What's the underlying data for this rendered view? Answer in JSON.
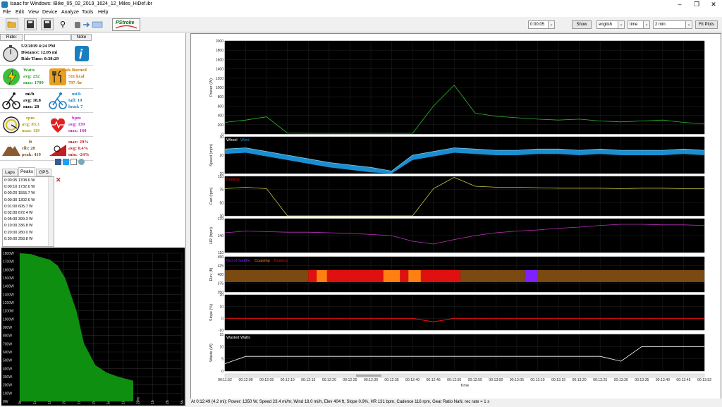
{
  "window": {
    "title": "Isaac for Windows: IBike_05_02_2019_1624_12_Miles_HiDef.ibr",
    "minimize": "–",
    "maximize": "❐",
    "close": "✕"
  },
  "menu": [
    "File",
    "Edit",
    "View",
    "Device",
    "Analyze",
    "Tools",
    "Help"
  ],
  "toolbar": {
    "pstroke_label": "PStroke",
    "interval": "0:00:05",
    "show_label": "Show",
    "units": "english",
    "xaxis": "time",
    "window": "2 min",
    "fit_label": "Fit Plots"
  },
  "ride": {
    "ride_tab": "Ride:",
    "note_tab": "Note",
    "date": "5/2/2019 4:24 PM",
    "distance": "Distance: 12.05 mi",
    "ride_time": "Ride Time: 0:38:29",
    "watts": {
      "label": "Watts",
      "avg": "avg: 232",
      "max": "max: 1709"
    },
    "cals": {
      "label": "Cals Burned",
      "total": "511 kcal",
      "rate": "797 /hr"
    },
    "speed": {
      "label": "mi/h",
      "avg": "avg: 18.8",
      "max": "max: 28"
    },
    "wind": {
      "label": "mi/h",
      "tail": "tail: 19",
      "head": "head: 7"
    },
    "cadence": {
      "label": "rpm",
      "avg": "avg: 83.3",
      "max": "max: 119"
    },
    "heart": {
      "label": "bpm",
      "avg": "avg: 139",
      "max": "max: 160"
    },
    "climb": {
      "label": "ft",
      "climb": "clb: 28",
      "peak": "peak: 419"
    },
    "slope": {
      "max": "max: 29%",
      "avg": "avg: 0.4%",
      "min": "min: -24%"
    }
  },
  "tabs": [
    "Laps",
    "Peaks",
    "GPS"
  ],
  "peaks": [
    "0:00:05 1708.6 W",
    "0:00:10 1732.6 W",
    "0:00:20 1555.7 W",
    "0:00:30 1302.6 W",
    "0:01:00 605.7 W",
    "0:02:00 672.4 W",
    "0:05:00 399.3 W",
    "0:10:00 336.8 W",
    "0:20:00 280.0 W",
    "0:30:00 258.8 W"
  ],
  "colors": {
    "power": "#2fb82f",
    "wind": "#1a8ed0",
    "cadence": "#c8c840",
    "hr": "#c030c0",
    "elev": "#7a4a10",
    "slope": "#e01010",
    "peaks_fill": "#0f8f0f",
    "out_of_saddle": "#8020ff",
    "coasting": "#ff8010",
    "braking": "#e01010"
  },
  "chart_data": [
    {
      "type": "area",
      "title": "",
      "xlabel": "",
      "ylabel": "",
      "yticks": [
        "1800W",
        "1700W",
        "1600W",
        "1500W",
        "1400W",
        "1300W",
        "1200W",
        "1100W",
        "1000W",
        "900W",
        "800W",
        "700W",
        "600W",
        "500W",
        "400W",
        "300W",
        "200W",
        "100W",
        "0W"
      ],
      "xticks": [
        "0s",
        "1s",
        "10s",
        "20s",
        "1m",
        "2m",
        "5m",
        "10m",
        "20m",
        "1h",
        "2h",
        "5h"
      ],
      "ylim": [
        0,
        1800
      ],
      "x": [
        0,
        0.3,
        0.5,
        0.8,
        1.0,
        1.2,
        1.5,
        1.7,
        2.0,
        2.3,
        2.6,
        3.0
      ],
      "values": [
        1800,
        1790,
        1760,
        1720,
        1650,
        1500,
        1100,
        700,
        440,
        350,
        300,
        250
      ]
    },
    {
      "type": "line",
      "title": "",
      "xlabel": "Time",
      "xticks": [
        "00:11:52",
        "00:12:00",
        "00:12:05",
        "00:12:10",
        "00:12:15",
        "00:12:20",
        "00:12:25",
        "00:12:30",
        "00:12:35",
        "00:12:40",
        "00:12:45",
        "00:12:50",
        "00:12:55",
        "00:13:00",
        "00:13:05",
        "00:13:10",
        "00:13:15",
        "00:13:20",
        "00:13:25",
        "00:13:30",
        "00:13:35",
        "00:13:40",
        "00:13:45",
        "00:13:52"
      ],
      "panels": [
        {
          "name": "power",
          "ylabel": "Power (W)",
          "yticks": [
            "2000",
            "1800",
            "1600",
            "1400",
            "1200",
            "1000",
            "800",
            "600",
            "400",
            "200",
            "0"
          ],
          "ylim": [
            0,
            2000
          ],
          "x": [
            0,
            1,
            2,
            3,
            4,
            5,
            6,
            7,
            8,
            9,
            10,
            11,
            12,
            13,
            14,
            15,
            16,
            17,
            18,
            19,
            20,
            21,
            22,
            23
          ],
          "values": [
            250,
            300,
            370,
            20,
            15,
            15,
            15,
            15,
            15,
            15,
            600,
            1050,
            450,
            380,
            350,
            320,
            300,
            320,
            280,
            260,
            280,
            300,
            250,
            220
          ]
        },
        {
          "name": "speed",
          "ylabel": "Speed (mph)",
          "legend": [
            "Wheel",
            "Wind"
          ],
          "yticks": [
            "30",
            "20",
            "10"
          ],
          "ylim": [
            0,
            30
          ],
          "x": [
            0,
            1,
            2,
            3,
            4,
            5,
            6,
            7,
            8,
            9,
            10,
            11,
            12,
            13,
            14,
            15,
            16,
            17,
            18,
            19,
            20,
            21,
            22,
            23
          ],
          "values": [
            20,
            21,
            18,
            15,
            12,
            9,
            7,
            5,
            2,
            15,
            18,
            21,
            20,
            19,
            19,
            20,
            20,
            19,
            20,
            19,
            19,
            19,
            20,
            19
          ]
        },
        {
          "name": "cadence",
          "ylabel": "Cad (rpm)",
          "legend": [
            "Braking"
          ],
          "yticks": [
            "110",
            "75",
            "50",
            "30"
          ],
          "ylim": [
            30,
            110
          ],
          "x": [
            0,
            1,
            2,
            3,
            4,
            5,
            6,
            7,
            8,
            9,
            10,
            11,
            12,
            13,
            14,
            15,
            16,
            17,
            18,
            19,
            20,
            21,
            22,
            23
          ],
          "values": [
            85,
            88,
            85,
            30,
            30,
            30,
            30,
            30,
            30,
            30,
            85,
            108,
            90,
            88,
            88,
            87,
            86,
            86,
            86,
            85,
            86,
            86,
            85,
            85
          ]
        },
        {
          "name": "hr",
          "ylabel": "HR (bpm)",
          "yticks": [
            "170",
            "140",
            "110"
          ],
          "ylim": [
            110,
            170
          ],
          "x": [
            0,
            1,
            2,
            3,
            4,
            5,
            6,
            7,
            8,
            9,
            10,
            11,
            12,
            13,
            14,
            15,
            16,
            17,
            18,
            19,
            20,
            21,
            22,
            23
          ],
          "values": [
            145,
            148,
            147,
            146,
            146,
            145,
            144,
            142,
            140,
            130,
            125,
            133,
            140,
            145,
            148,
            150,
            153,
            155,
            158,
            160,
            160,
            159,
            159,
            158
          ]
        },
        {
          "name": "elev",
          "ylabel": "Elev (ft)",
          "legend": [
            "Out of Saddle",
            "Coasting",
            "Braking"
          ],
          "yticks": [
            "450",
            "425",
            "400",
            "375",
            "350"
          ],
          "ylim": [
            350,
            450
          ],
          "values": [
            400,
            401,
            402,
            401,
            401,
            402,
            401,
            402,
            401,
            400,
            402,
            403,
            402,
            401,
            402,
            401,
            402,
            401,
            402,
            403,
            402,
            403,
            403,
            402
          ]
        },
        {
          "name": "slope",
          "ylabel": "Slope (%)",
          "yticks": [
            "20",
            "10",
            "0",
            "-10"
          ],
          "ylim": [
            -10,
            20
          ],
          "x": [
            0,
            1,
            2,
            3,
            4,
            5,
            6,
            7,
            8,
            9,
            10,
            11,
            12,
            13,
            14,
            15,
            16,
            17,
            18,
            19,
            20,
            21,
            22,
            23
          ],
          "values": [
            0,
            0,
            0,
            0,
            0,
            0,
            0,
            0,
            0,
            0,
            -3,
            0,
            0,
            0,
            0,
            0,
            0,
            0,
            0,
            0,
            0,
            0,
            0,
            0
          ]
        },
        {
          "name": "wasted",
          "ylabel": "Waste (W)",
          "legend": [
            "Wasted Watts"
          ],
          "yticks": [
            "15",
            "10",
            "5",
            "0"
          ],
          "ylim": [
            0,
            15
          ],
          "x": [
            0,
            1,
            2,
            3,
            4,
            5,
            6,
            7,
            8,
            9,
            10,
            11,
            12,
            13,
            14,
            15,
            16,
            17,
            18,
            19,
            20,
            21,
            22,
            23
          ],
          "values": [
            3,
            6,
            6,
            6,
            6,
            6,
            6,
            6,
            6,
            6,
            6,
            6,
            6,
            6,
            6,
            6,
            6,
            6,
            6,
            4,
            10,
            10,
            10,
            10
          ]
        }
      ]
    }
  ],
  "status": "At 0:12:49 (4.2 mi): Power: 1350 W, Speed 23.4 mi/hr, Wind 18.0 mi/h, Elev 404 ft, Slope 0.9%, HR 131 bpm, Cadence 116 rpm, Gear Ratio NaN, rec rate = 1 s"
}
